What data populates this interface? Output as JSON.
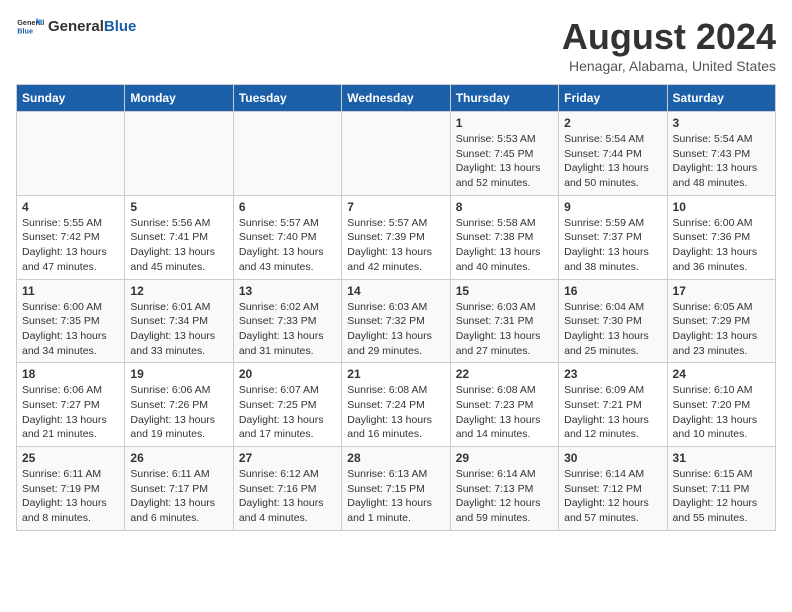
{
  "header": {
    "logo_general": "General",
    "logo_blue": "Blue",
    "main_title": "August 2024",
    "subtitle": "Henagar, Alabama, United States"
  },
  "calendar": {
    "columns": [
      "Sunday",
      "Monday",
      "Tuesday",
      "Wednesday",
      "Thursday",
      "Friday",
      "Saturday"
    ],
    "weeks": [
      [
        {
          "day": "",
          "info": ""
        },
        {
          "day": "",
          "info": ""
        },
        {
          "day": "",
          "info": ""
        },
        {
          "day": "",
          "info": ""
        },
        {
          "day": "1",
          "info": "Sunrise: 5:53 AM\nSunset: 7:45 PM\nDaylight: 13 hours\nand 52 minutes."
        },
        {
          "day": "2",
          "info": "Sunrise: 5:54 AM\nSunset: 7:44 PM\nDaylight: 13 hours\nand 50 minutes."
        },
        {
          "day": "3",
          "info": "Sunrise: 5:54 AM\nSunset: 7:43 PM\nDaylight: 13 hours\nand 48 minutes."
        }
      ],
      [
        {
          "day": "4",
          "info": "Sunrise: 5:55 AM\nSunset: 7:42 PM\nDaylight: 13 hours\nand 47 minutes."
        },
        {
          "day": "5",
          "info": "Sunrise: 5:56 AM\nSunset: 7:41 PM\nDaylight: 13 hours\nand 45 minutes."
        },
        {
          "day": "6",
          "info": "Sunrise: 5:57 AM\nSunset: 7:40 PM\nDaylight: 13 hours\nand 43 minutes."
        },
        {
          "day": "7",
          "info": "Sunrise: 5:57 AM\nSunset: 7:39 PM\nDaylight: 13 hours\nand 42 minutes."
        },
        {
          "day": "8",
          "info": "Sunrise: 5:58 AM\nSunset: 7:38 PM\nDaylight: 13 hours\nand 40 minutes."
        },
        {
          "day": "9",
          "info": "Sunrise: 5:59 AM\nSunset: 7:37 PM\nDaylight: 13 hours\nand 38 minutes."
        },
        {
          "day": "10",
          "info": "Sunrise: 6:00 AM\nSunset: 7:36 PM\nDaylight: 13 hours\nand 36 minutes."
        }
      ],
      [
        {
          "day": "11",
          "info": "Sunrise: 6:00 AM\nSunset: 7:35 PM\nDaylight: 13 hours\nand 34 minutes."
        },
        {
          "day": "12",
          "info": "Sunrise: 6:01 AM\nSunset: 7:34 PM\nDaylight: 13 hours\nand 33 minutes."
        },
        {
          "day": "13",
          "info": "Sunrise: 6:02 AM\nSunset: 7:33 PM\nDaylight: 13 hours\nand 31 minutes."
        },
        {
          "day": "14",
          "info": "Sunrise: 6:03 AM\nSunset: 7:32 PM\nDaylight: 13 hours\nand 29 minutes."
        },
        {
          "day": "15",
          "info": "Sunrise: 6:03 AM\nSunset: 7:31 PM\nDaylight: 13 hours\nand 27 minutes."
        },
        {
          "day": "16",
          "info": "Sunrise: 6:04 AM\nSunset: 7:30 PM\nDaylight: 13 hours\nand 25 minutes."
        },
        {
          "day": "17",
          "info": "Sunrise: 6:05 AM\nSunset: 7:29 PM\nDaylight: 13 hours\nand 23 minutes."
        }
      ],
      [
        {
          "day": "18",
          "info": "Sunrise: 6:06 AM\nSunset: 7:27 PM\nDaylight: 13 hours\nand 21 minutes."
        },
        {
          "day": "19",
          "info": "Sunrise: 6:06 AM\nSunset: 7:26 PM\nDaylight: 13 hours\nand 19 minutes."
        },
        {
          "day": "20",
          "info": "Sunrise: 6:07 AM\nSunset: 7:25 PM\nDaylight: 13 hours\nand 17 minutes."
        },
        {
          "day": "21",
          "info": "Sunrise: 6:08 AM\nSunset: 7:24 PM\nDaylight: 13 hours\nand 16 minutes."
        },
        {
          "day": "22",
          "info": "Sunrise: 6:08 AM\nSunset: 7:23 PM\nDaylight: 13 hours\nand 14 minutes."
        },
        {
          "day": "23",
          "info": "Sunrise: 6:09 AM\nSunset: 7:21 PM\nDaylight: 13 hours\nand 12 minutes."
        },
        {
          "day": "24",
          "info": "Sunrise: 6:10 AM\nSunset: 7:20 PM\nDaylight: 13 hours\nand 10 minutes."
        }
      ],
      [
        {
          "day": "25",
          "info": "Sunrise: 6:11 AM\nSunset: 7:19 PM\nDaylight: 13 hours\nand 8 minutes."
        },
        {
          "day": "26",
          "info": "Sunrise: 6:11 AM\nSunset: 7:17 PM\nDaylight: 13 hours\nand 6 minutes."
        },
        {
          "day": "27",
          "info": "Sunrise: 6:12 AM\nSunset: 7:16 PM\nDaylight: 13 hours\nand 4 minutes."
        },
        {
          "day": "28",
          "info": "Sunrise: 6:13 AM\nSunset: 7:15 PM\nDaylight: 13 hours\nand 1 minute."
        },
        {
          "day": "29",
          "info": "Sunrise: 6:14 AM\nSunset: 7:13 PM\nDaylight: 12 hours\nand 59 minutes."
        },
        {
          "day": "30",
          "info": "Sunrise: 6:14 AM\nSunset: 7:12 PM\nDaylight: 12 hours\nand 57 minutes."
        },
        {
          "day": "31",
          "info": "Sunrise: 6:15 AM\nSunset: 7:11 PM\nDaylight: 12 hours\nand 55 minutes."
        }
      ]
    ]
  }
}
